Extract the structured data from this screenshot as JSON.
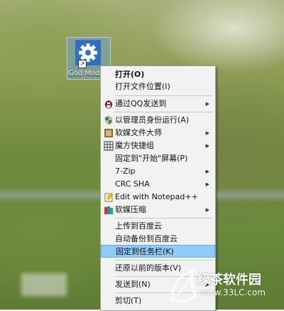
{
  "desktop": {
    "icon_label": "God Mod",
    "shortcut_glyph": "↗"
  },
  "context_menu": {
    "items": [
      {
        "label": "打开(O)",
        "bold": true,
        "icon": "",
        "submenu": false
      },
      {
        "label": "打开文件位置(I)",
        "icon": "",
        "submenu": false
      },
      {
        "label": "通过QQ发送到",
        "icon": "qq-penguin-icon",
        "submenu": true
      },
      {
        "label": "以管理员身份运行(A)",
        "icon": "uac-shield-icon",
        "submenu": false
      },
      {
        "label": "软媒文件大师",
        "icon": "ruanmei-file-icon",
        "submenu": true
      },
      {
        "label": "魔方快捷组",
        "icon": "grid-icon",
        "submenu": true
      },
      {
        "label": "固定到\"开始\"屏幕(P)",
        "icon": "",
        "submenu": false
      },
      {
        "label": "7-Zip",
        "icon": "",
        "submenu": true
      },
      {
        "label": "CRC SHA",
        "icon": "",
        "submenu": true
      },
      {
        "label": "Edit with Notepad++",
        "icon": "notepad-plus-icon",
        "submenu": false
      },
      {
        "label": "软媒压缩",
        "icon": "archive-books-icon",
        "submenu": true
      },
      {
        "label": "上传到百度云",
        "icon": "",
        "submenu": false
      },
      {
        "label": "自动备份到百度云",
        "icon": "",
        "submenu": false
      },
      {
        "label": "固定到任务栏(K)",
        "icon": "",
        "submenu": false,
        "highlighted": true
      },
      {
        "label": "还原以前的版本(V)",
        "icon": "",
        "submenu": false
      },
      {
        "label": "发送到(N)",
        "icon": "",
        "submenu": true
      },
      {
        "label": "剪切(T)",
        "icon": "",
        "submenu": false
      }
    ],
    "arrow_glyph": "▶"
  },
  "watermark": {
    "name": "绿茶软件园",
    "url": "www.33LC.com"
  },
  "colors": {
    "menu_bg": "#f2f2f2",
    "highlight": "#91c9f7",
    "highlight_border": "#6aa9e6",
    "icon_select": "#6ea0dc"
  }
}
